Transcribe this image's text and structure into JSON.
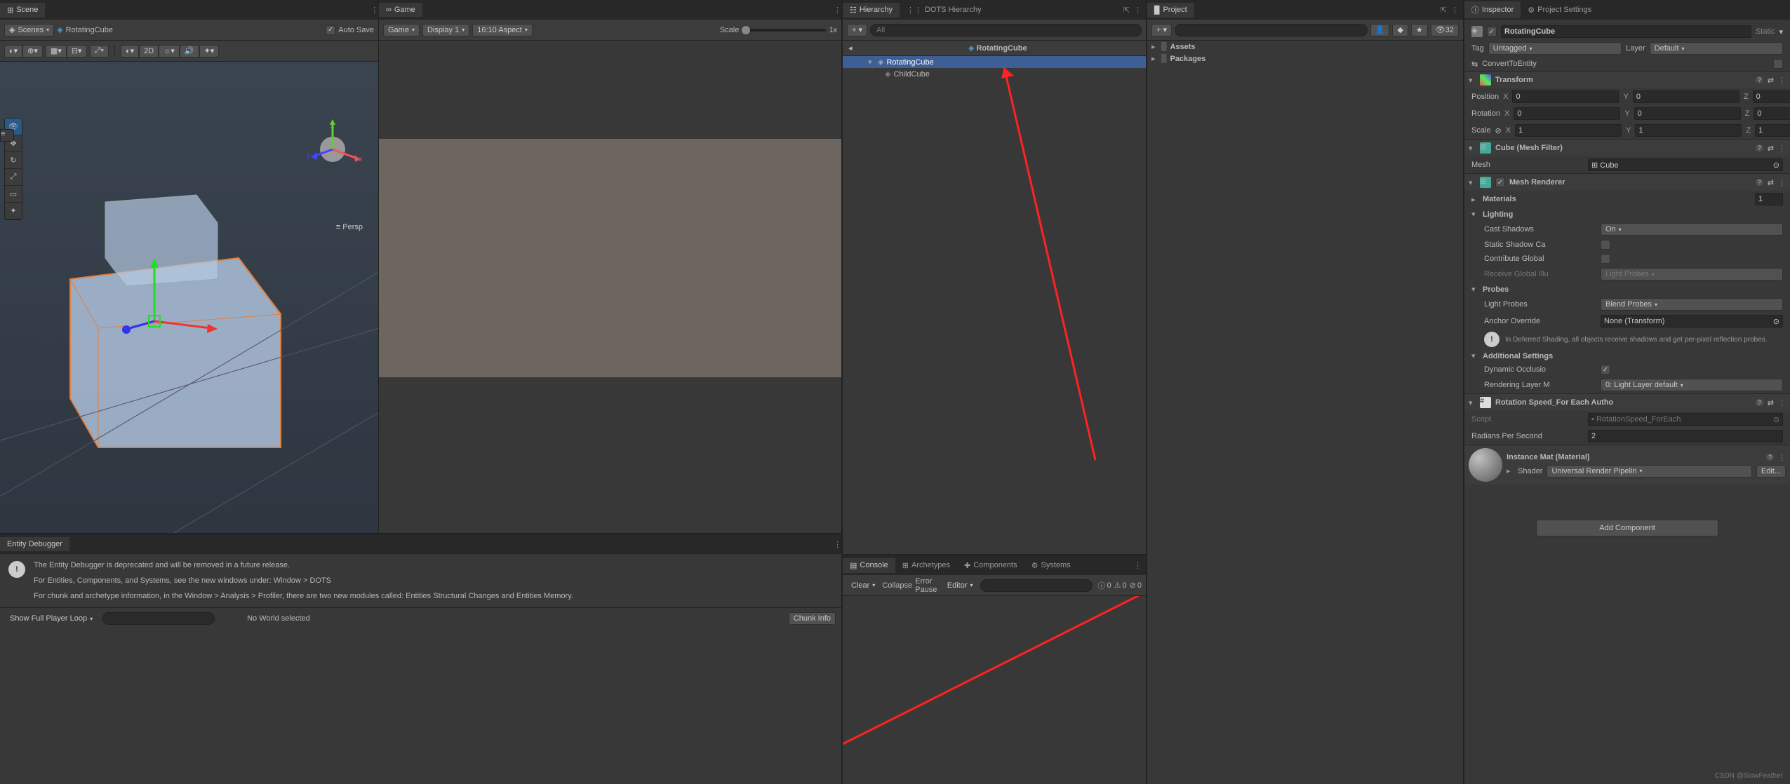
{
  "scene_panel": {
    "tabs": {
      "scene": "Scene",
      "game": "Game"
    },
    "sub": {
      "scenes": "Scenes",
      "open_scene": "RotatingCube",
      "auto_save": "Auto Save",
      "persp": "Persp",
      "twod": "2D"
    }
  },
  "game_panel": {
    "sub": {
      "game": "Game",
      "display": "Display 1",
      "aspect": "16:10 Aspect",
      "scale": "Scale",
      "zoom": "1x"
    }
  },
  "hierarchy": {
    "tabs": {
      "hierarchy": "Hierarchy",
      "dots": "DOTS Hierarchy"
    },
    "search_ph": "All",
    "breadcrumb": "RotatingCube",
    "items": [
      "RotatingCube",
      "ChildCube"
    ]
  },
  "project": {
    "tab": "Project",
    "count": "32",
    "root": [
      "Assets",
      "Packages"
    ]
  },
  "console": {
    "tabs": {
      "console": "Console",
      "arch": "Archetypes",
      "comp": "Components",
      "sys": "Systems"
    },
    "toolbar": {
      "clear": "Clear",
      "collapse": "Collapse",
      "error_pause": "Error Pause",
      "editor": "Editor"
    },
    "counts": {
      "info": "0",
      "warn": "0",
      "err": "0"
    }
  },
  "entity_dbg": {
    "tab": "Entity Debugger",
    "msg1": "The Entity Debugger is deprecated and will be removed in a future release.",
    "msg2": "For Entities, Components, and Systems, see the new windows under: Window > DOTS",
    "msg3": "For chunk and archetype information, in the Window > Analysis > Profiler, there are two new modules called: Entities Structural Changes and Entities Memory.",
    "show_loop": "Show Full Player Loop",
    "no_world": "No World selected",
    "chunk": "Chunk Info"
  },
  "inspector": {
    "tabs": {
      "inspector": "Inspector",
      "proj_settings": "Project Settings"
    },
    "name": "RotatingCube",
    "static": "Static",
    "tag_lbl": "Tag",
    "tag_val": "Untagged",
    "layer_lbl": "Layer",
    "layer_val": "Default",
    "convert": "ConvertToEntity",
    "transform": {
      "title": "Transform",
      "pos_lbl": "Position",
      "rot_lbl": "Rotation",
      "scl_lbl": "Scale",
      "pos": {
        "x": "0",
        "y": "0",
        "z": "0"
      },
      "rot": {
        "x": "0",
        "y": "0",
        "z": "0"
      },
      "scl": {
        "x": "1",
        "y": "1",
        "z": "1"
      }
    },
    "mesh_filter": {
      "title": "Cube (Mesh Filter)",
      "mesh_lbl": "Mesh",
      "mesh_val": "Cube"
    },
    "mesh_renderer": {
      "title": "Mesh Renderer",
      "materials": "Materials",
      "mat_count": "1",
      "lighting": "Lighting",
      "cast_shadows": "Cast Shadows",
      "cast_shadows_val": "On",
      "static_shadow": "Static Shadow Ca",
      "contribute": "Contribute Global",
      "recv_gi": "Receive Global Illu",
      "recv_gi_val": "Light Probes",
      "probes": "Probes",
      "light_probes": "Light Probes",
      "light_probes_val": "Blend Probes",
      "anchor": "Anchor Override",
      "anchor_val": "None (Transform)",
      "deferred_msg": "In Deferred Shading, all objects receive shadows and get per-pixel reflection probes.",
      "additional": "Additional Settings",
      "dyn_occ": "Dynamic Occlusio",
      "render_layer": "Rendering Layer M",
      "render_layer_val": "0: Light Layer default"
    },
    "rot_speed": {
      "title": "Rotation Speed_For Each Autho",
      "script_lbl": "Script",
      "script_val": "RotationSpeed_ForEach",
      "rad_lbl": "Radians Per Second",
      "rad_val": "2"
    },
    "material": {
      "title": "Instance Mat (Material)",
      "shader_lbl": "Shader",
      "shader_val": "Universal Render Pipelin",
      "edit": "Edit..."
    },
    "add_comp": "Add Component"
  },
  "watermark": "CSDN @SlowFeather"
}
